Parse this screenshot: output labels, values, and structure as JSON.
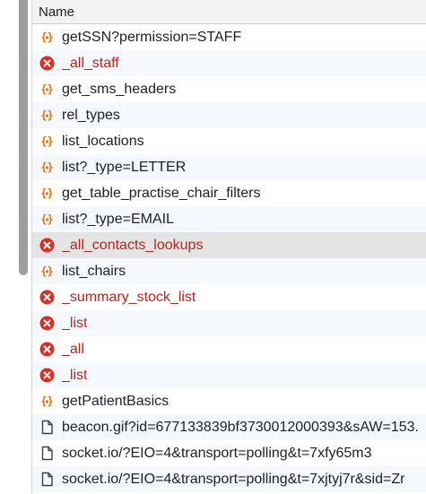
{
  "table": {
    "column_header": "Name"
  },
  "requests": [
    {
      "name": "getSSN?permission=STAFF",
      "status": "ok",
      "icon": "fetch-braces-icon"
    },
    {
      "name": "_all_staff",
      "status": "error",
      "icon": "error-circle-icon"
    },
    {
      "name": "get_sms_headers",
      "status": "ok",
      "icon": "fetch-braces-icon"
    },
    {
      "name": "rel_types",
      "status": "ok",
      "icon": "fetch-braces-icon"
    },
    {
      "name": "list_locations",
      "status": "ok",
      "icon": "fetch-braces-icon"
    },
    {
      "name": "list?_type=LETTER",
      "status": "ok",
      "icon": "fetch-braces-icon"
    },
    {
      "name": "get_table_practise_chair_filters",
      "status": "ok",
      "icon": "fetch-braces-icon"
    },
    {
      "name": "list?_type=EMAIL",
      "status": "ok",
      "icon": "fetch-braces-icon"
    },
    {
      "name": "_all_contacts_lookups",
      "status": "error",
      "icon": "error-circle-icon",
      "selected": true
    },
    {
      "name": "list_chairs",
      "status": "ok",
      "icon": "fetch-braces-icon"
    },
    {
      "name": "_summary_stock_list",
      "status": "error",
      "icon": "error-circle-icon"
    },
    {
      "name": "_list",
      "status": "error",
      "icon": "error-circle-icon"
    },
    {
      "name": "_all",
      "status": "error",
      "icon": "error-circle-icon"
    },
    {
      "name": "_list",
      "status": "error",
      "icon": "error-circle-icon"
    },
    {
      "name": "getPatientBasics",
      "status": "ok",
      "icon": "fetch-braces-icon"
    },
    {
      "name": "beacon.gif?id=677133839bf3730012000393&sAW=153.",
      "status": "doc",
      "icon": "document-icon"
    },
    {
      "name": "socket.io/?EIO=4&transport=polling&t=7xfy65m3",
      "status": "doc",
      "icon": "document-icon"
    },
    {
      "name": "socket.io/?EIO=4&transport=polling&t=7xjtyj7r&sid=Zr",
      "status": "doc",
      "icon": "document-icon"
    }
  ],
  "colors": {
    "error_text": "#b3261e",
    "error_icon": "#d93025",
    "fetch_icon": "#e8710a",
    "doc_icon": "#3c4043",
    "selected_row": "#e4e4e4"
  }
}
